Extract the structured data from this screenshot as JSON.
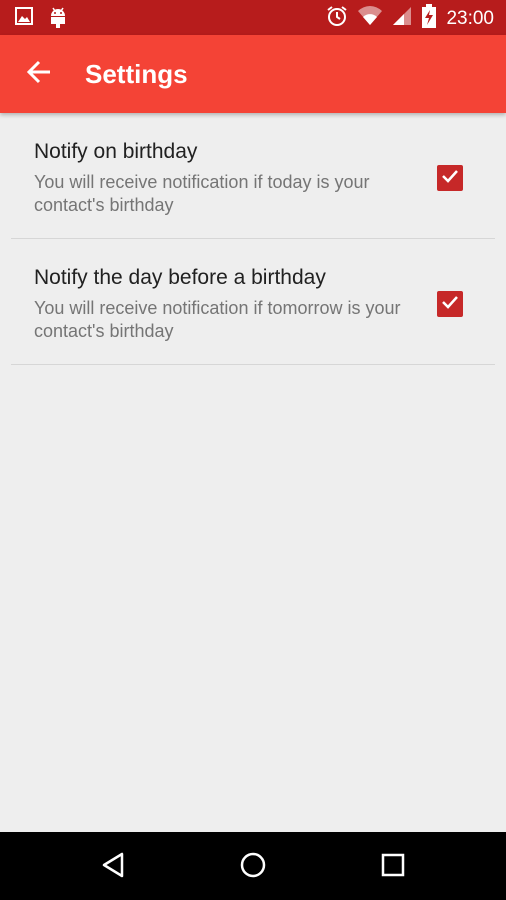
{
  "status_bar": {
    "time": "23:00",
    "icons": [
      "image-icon",
      "android-icon",
      "alarm-icon",
      "wifi-icon",
      "signal-icon",
      "battery-charging-icon"
    ]
  },
  "app_bar": {
    "title": "Settings",
    "back_icon": "arrow-back-icon"
  },
  "preferences": [
    {
      "title": "Notify on birthday",
      "summary": "You will receive notification if today is your contact's birthday",
      "checked": true
    },
    {
      "title": "Notify the day before a birthday",
      "summary": "You will receive notification if tomorrow is your contact's birthday",
      "checked": true
    }
  ],
  "nav_bar": {
    "buttons": [
      "back-triangle-icon",
      "home-circle-icon",
      "recents-square-icon"
    ]
  },
  "colors": {
    "status_bar": "#b71c1c",
    "app_bar": "#f44336",
    "checkbox": "#c62828",
    "background": "#eeeeee"
  }
}
